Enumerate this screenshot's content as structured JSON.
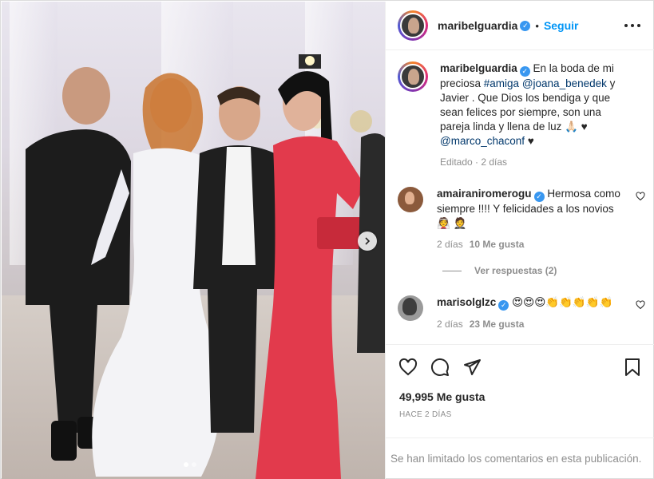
{
  "post": {
    "author": "maribelguardia",
    "follow_label": "Seguir",
    "separator": "•",
    "carousel": {
      "current": 1,
      "total": 2
    }
  },
  "caption": {
    "username": "maribelguardia",
    "text_1": "En la boda de mi preciosa ",
    "hashtag": "#amiga",
    "mention_1": "@joana_benedek",
    "text_2": " y Javier . Que Dios los bendiga y que sean felices por siempre, son una pareja linda y llena de luz 🙏🏻 ♥ ",
    "mention_2": "@marco_chaconf",
    "text_3": " ♥",
    "meta": "Editado · 2 días"
  },
  "comments": [
    {
      "username": "amairaniromerogu",
      "text": "Hermosa como siempre !!!! Y felicidades a los novios 👰 🤵",
      "time": "2 días",
      "likes": "10 Me gusta"
    },
    {
      "username": "marisolglzc",
      "text": "😍😍😍👏👏👏👏👏",
      "time": "2 días",
      "likes": "23 Me gusta"
    }
  ],
  "view_replies": "Ver respuestas (2)",
  "likes_count": "49,995 Me gusta",
  "posted_time": "HACE 2 DÍAS",
  "comments_limited": "Se han limitado los comentarios en esta publicación.",
  "colors": {
    "link": "#0095f6",
    "mention": "#00376b",
    "verified": "#3897f0",
    "dress_red": "#e23a4c"
  }
}
